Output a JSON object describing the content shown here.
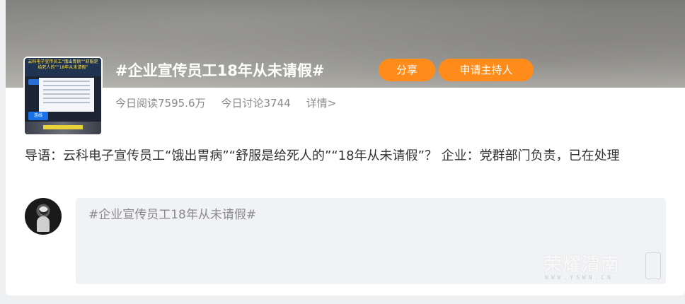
{
  "topic": {
    "title": "#企业宣传员工18年从未请假#",
    "share_label": "分享",
    "host_label": "申请主持人",
    "reads": "今日阅读7595.6万",
    "discussions": "今日讨论3744",
    "detail_link": "详情>"
  },
  "thumbnail": {
    "headline": "云科电子宣传员工“饿出胃病”“舒服是给死人的”“18年从未请假”",
    "badge": "正直",
    "tag": "连线"
  },
  "guide": {
    "text": "导语：云科电子宣传员工“饿出胃病”“舒服是给死人的”“18年从未请假”？ 企业：党群部门负责，已在处理"
  },
  "compose": {
    "placeholder": "#企业宣传员工18年从未请假#"
  },
  "watermark": {
    "name": "荣耀渭南",
    "url": "WWW.YSWN.CN"
  },
  "colors": {
    "accent": "#ff8c1a",
    "muted_text": "#8a8a8a",
    "input_bg": "#f1f2f5"
  }
}
